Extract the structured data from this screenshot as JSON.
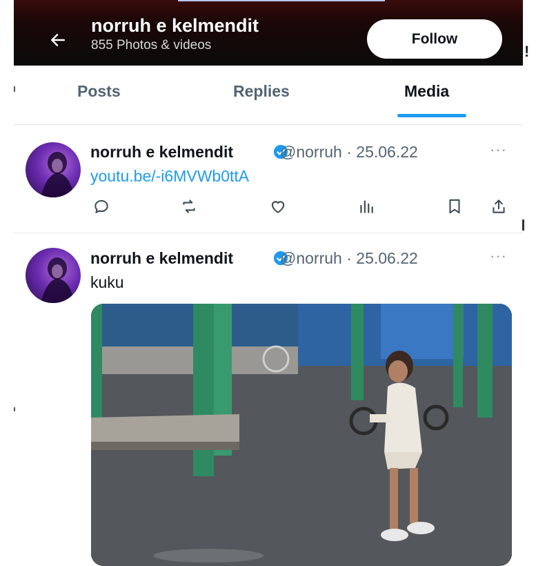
{
  "header": {
    "title": "norruh e kelmendit",
    "subtitle": "855 Photos & videos",
    "follow_label": "Follow",
    "edge_text": "!"
  },
  "tabs": [
    {
      "label": "Posts",
      "active": false
    },
    {
      "label": "Replies",
      "active": false
    },
    {
      "label": "Media",
      "active": true
    }
  ],
  "tweets": [
    {
      "name": "norruh e kelmendit",
      "handle": "@norruh · 25.06.22",
      "link": "youtu.be/-i6MVWb0ttA",
      "more": "···",
      "actions": [
        "reply-icon",
        "retweet-icon",
        "like-icon",
        "views-icon",
        "bookmark-icon",
        "share-icon"
      ]
    },
    {
      "name": "norruh e kelmendit",
      "handle": "@norruh · 25.06.22",
      "text": "kuku",
      "more": "···",
      "media_description": "video-thumbnail"
    }
  ],
  "colors": {
    "accent": "#1d9bf0",
    "text": "#0f1419",
    "muted": "#536471",
    "header_bg": "#0b0b0b"
  }
}
